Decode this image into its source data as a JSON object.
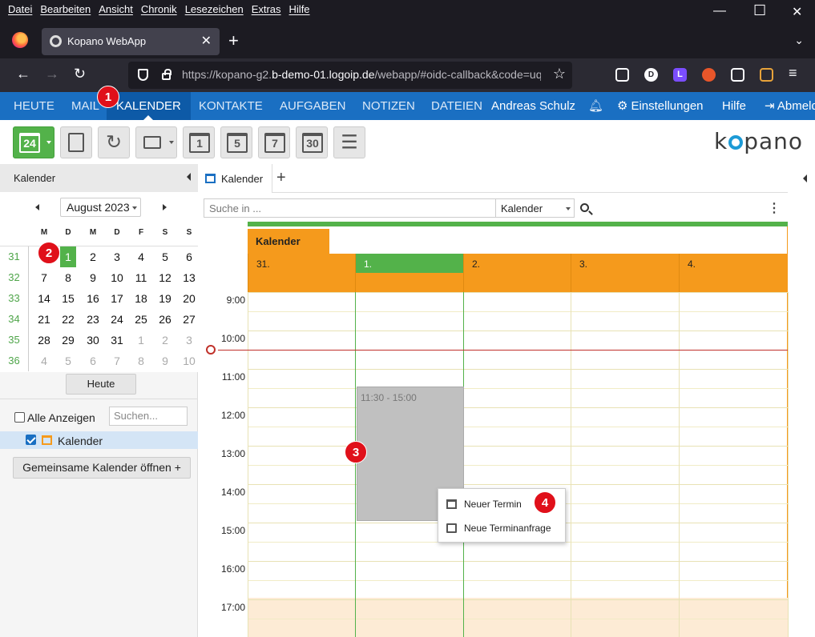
{
  "browser": {
    "menus": [
      "Datei",
      "Bearbeiten",
      "Ansicht",
      "Chronik",
      "Lesezeichen",
      "Extras",
      "Hilfe"
    ],
    "tab_title": "Kopano WebApp",
    "url_prefix": "https://kopano-g2.",
    "url_domain": "b-demo-01.logoip.de",
    "url_path": "/webapp/#oidc-callback&code=uq",
    "extension_letters": [
      "D",
      "L"
    ]
  },
  "appnav": {
    "items": [
      "HEUTE",
      "MAIL",
      "KALENDER",
      "KONTAKTE",
      "AUFGABEN",
      "NOTIZEN",
      "DATEIEN"
    ],
    "user": "Andreas Schulz",
    "settings": "Einstellungen",
    "help": "Hilfe",
    "logout": "Abmelden",
    "accent": "#1a6fc2"
  },
  "toolbar": {
    "today_num": "24",
    "view_nums": [
      "1",
      "5",
      "7",
      "30"
    ],
    "logo": "k",
    "logo_rest": "pano"
  },
  "sidebar": {
    "title": "Kalender",
    "month": "August 2023",
    "dow": [
      "M",
      "D",
      "M",
      "D",
      "F",
      "S",
      "S"
    ],
    "weeks": [
      {
        "wk": "31",
        "days": [
          "",
          "1",
          "2",
          "3",
          "4",
          "5",
          "6"
        ]
      },
      {
        "wk": "32",
        "days": [
          "7",
          "8",
          "9",
          "10",
          "11",
          "12",
          "13"
        ]
      },
      {
        "wk": "33",
        "days": [
          "14",
          "15",
          "16",
          "17",
          "18",
          "19",
          "20"
        ]
      },
      {
        "wk": "34",
        "days": [
          "21",
          "22",
          "23",
          "24",
          "25",
          "26",
          "27"
        ]
      },
      {
        "wk": "35",
        "days": [
          "28",
          "29",
          "30",
          "31",
          "1",
          "2",
          "3"
        ]
      },
      {
        "wk": "36",
        "days": [
          "4",
          "5",
          "6",
          "7",
          "8",
          "9",
          "10"
        ]
      }
    ],
    "heute": "Heute",
    "alle": "Alle Anzeigen",
    "search_placeholder": "Suchen...",
    "calendar_name": "Kalender",
    "shared_button": "Gemeinsame Kalender öffnen +"
  },
  "main": {
    "tab": "Kalender",
    "search_placeholder": "Suche in ...",
    "scope": "Kalender",
    "cal_label": "Kalender",
    "days": [
      "31.",
      "1.",
      "2.",
      "3.",
      "4."
    ],
    "hours": [
      "9:00",
      "10:00",
      "11:00",
      "12:00",
      "13:00",
      "14:00",
      "15:00",
      "16:00",
      "17:00"
    ],
    "selection": "11:30 - 15:00"
  },
  "context_menu": {
    "items": [
      "Neuer Termin",
      "Neue Terminanfrage"
    ]
  },
  "markers": [
    "1",
    "2",
    "3",
    "4"
  ]
}
